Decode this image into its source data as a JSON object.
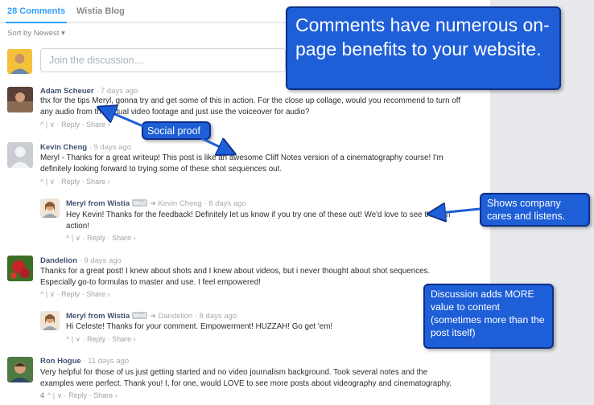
{
  "tabs": {
    "comments": "28 Comments",
    "community": "Wistia Blog"
  },
  "sort": "Sort by Newest ▾",
  "compose_placeholder": "Join the discussion…",
  "comments": [
    {
      "author": "Adam Scheuer",
      "meta": "· 7 days ago",
      "line1": "thx for the tips Meryl, gonna try and get some of this in action. For the close up collage, would you recommend to turn off",
      "line2": "any audio from the actual video footage and just use the voiceover for audio?",
      "footer": "^ | ∨ · Reply · Share ›"
    },
    {
      "author": "Kevin Cheng",
      "meta": "· 9 days ago",
      "line1": "Meryl - Thanks for a great writeup! This post is like an awesome Cliff Notes version of a cinematography course! I'm",
      "line2": "definitely looking forward to trying some of these shot sequences out.",
      "footer": "^ | ∨ · Reply · Share ›"
    },
    {
      "author": "Meryl from Wistia",
      "badge": "Mod",
      "meta": "➜ Kevin Cheng · 8 days ago",
      "line1": "Hey Kevin! Thanks for the feedback! Definitely let us know if you try one of these out! We'd love to see them in",
      "line2": "action!",
      "footer": "^ | ∨ · Reply · Share ›"
    },
    {
      "author": "Dandelion",
      "meta": "· 9 days ago",
      "line1": "Thanks for a great post! I knew about shots and I knew about videos, but i never thought about shot sequences.",
      "line2": "Especially go-to formulas to master and use. I feel empowered!",
      "footer": "^ | ∨ · Reply · Share ›"
    },
    {
      "author": "Meryl from Wistia",
      "badge": "Mod",
      "meta": "➜ Dandelion · 8 days ago",
      "line1": "Hi Celeste! Thanks for your comment. Empowerment! HUZZAH! Go get 'em!",
      "line2": "",
      "footer": "^ | ∨ · Reply · Share ›"
    },
    {
      "author": "Ron Hogue",
      "meta": "· 11 days ago",
      "line1": "Very helpful for those of us just getting started and no video journalism background. Took several notes and the",
      "line2": "examples were perfect. Thank you! I, for one, would LOVE to see more posts about videography and cinematography.",
      "count": "4",
      "footer": "^ | ∨ · Reply · Share ›"
    }
  ],
  "callouts": {
    "big": "Comments have numerous on-page benefits to your website.",
    "social": "Social proof",
    "shows": "Shows company cares and listens.",
    "adds": "Discussion adds MORE value to content (sometimes more than the post itself)"
  },
  "colors": {
    "accent": "#2e9fff",
    "callout": "#1e5ed6",
    "author": "#3f5171"
  }
}
